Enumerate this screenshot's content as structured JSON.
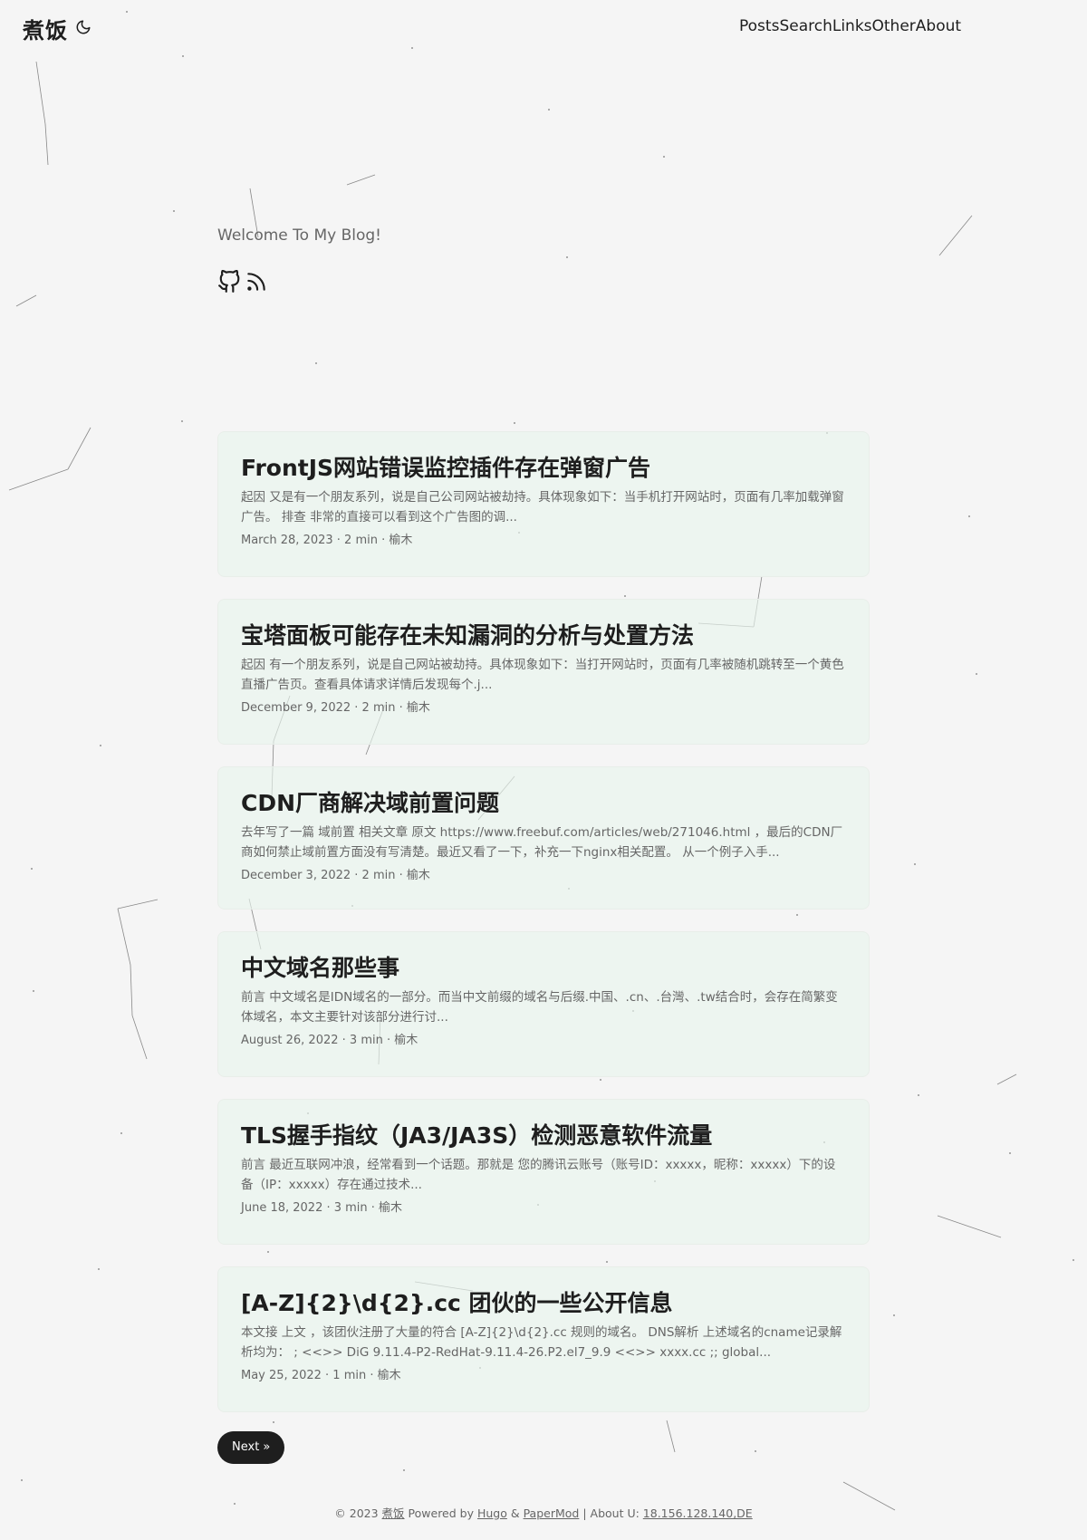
{
  "site": {
    "logo": "煮饭"
  },
  "nav": {
    "items": [
      {
        "label": "Posts"
      },
      {
        "label": "Search"
      },
      {
        "label": "Links"
      },
      {
        "label": "Other"
      },
      {
        "label": "About"
      }
    ]
  },
  "home": {
    "welcome": "Welcome To My Blog!"
  },
  "icons": {
    "theme_toggle": "moon-icon",
    "social": [
      "github-icon",
      "rss-icon"
    ]
  },
  "posts": [
    {
      "title": "FrontJS网站错误监控插件存在弹窗广告",
      "summary": "起因 又是有一个朋友系列，说是自己公司网站被劫持。具体现象如下：当手机打开网站时，页面有几率加载弹窗广告。 排查 非常的直接可以看到这个广告图的调...",
      "meta": "March 28, 2023 · 2 min · 榆木"
    },
    {
      "title": "宝塔面板可能存在未知漏洞的分析与处置方法",
      "summary": "起因 有一个朋友系列，说是自己网站被劫持。具体现象如下：当打开网站时，页面有几率被随机跳转至一个黄色直播广告页。查看具体请求详情后发现每个.j...",
      "meta": "December 9, 2022 · 2 min · 榆木"
    },
    {
      "title": "CDN厂商解决域前置问题",
      "summary": "去年写了一篇 域前置 相关文章 原文 https://www.freebuf.com/articles/web/271046.html ，最后的CDN厂商如何禁止域前置方面没有写清楚。最近又看了一下，补充一下nginx相关配置。 从一个例子入手...",
      "meta": "December 3, 2022 · 2 min · 榆木"
    },
    {
      "title": "中文域名那些事",
      "summary": "前言 中文域名是IDN域名的一部分。而当中文前缀的域名与后缀.中国、.cn、.台灣、.tw结合时，会存在简繁变体域名，本文主要针对该部分进行讨...",
      "meta": "August 26, 2022 · 3 min · 榆木"
    },
    {
      "title": "TLS握手指纹（JA3/JA3S）检测恶意软件流量",
      "summary": "前言 最近互联网冲浪，经常看到一个话题。那就是 您的腾讯云账号（账号ID：xxxxx，昵称：xxxxx）下的设备（IP：xxxxx）存在通过技术...",
      "meta": "June 18, 2022 · 3 min · 榆木"
    },
    {
      "title": "[A-Z]{2}\\d{2}.cc 团伙的一些公开信息",
      "summary": "本文接 上文 ，该团伙注册了大量的符合 [A-Z]{2}\\d{2}.cc 规则的域名。 DNS解析 上述域名的cname记录解析均为： ; <<>> DiG 9.11.4-P2-RedHat-9.11.4-26.P2.el7_9.9 <<>> xxxx.cc ;; global...",
      "meta": "May 25, 2022 · 1 min · 榆木"
    }
  ],
  "pagination": {
    "next": "Next  »"
  },
  "footer": {
    "copyright": "© 2023 ",
    "site_link": "煮饭",
    "powered_by": " Powered by ",
    "hugo": "Hugo",
    "amp": " & ",
    "papermod": "PaperMod",
    "about_sep": " | About U: ",
    "visitor": "18.156.128.140,DE"
  }
}
